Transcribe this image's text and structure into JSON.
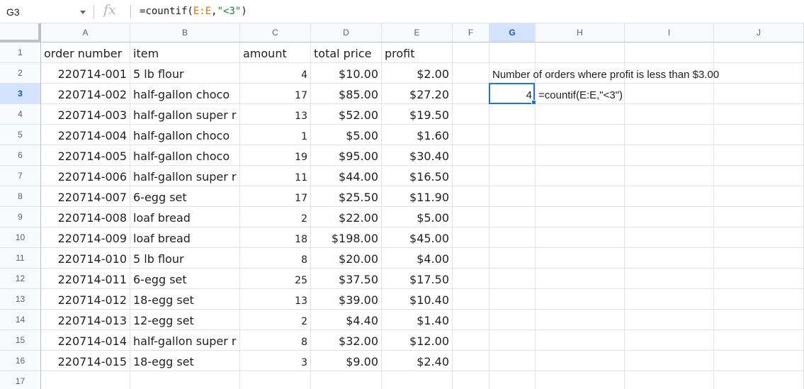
{
  "formula_bar": {
    "name_box": "G3",
    "fx_icon": "fx-icon",
    "formula_prefix": "=countif(",
    "formula_ref": "E:E",
    "formula_comma": ",",
    "formula_string": "\"<3\"",
    "formula_suffix": ")"
  },
  "columns": [
    "A",
    "B",
    "C",
    "D",
    "E",
    "F",
    "G",
    "H",
    "I",
    "J"
  ],
  "row_numbers": [
    "1",
    "2",
    "3",
    "4",
    "5",
    "6",
    "7",
    "8",
    "9",
    "10",
    "11",
    "12",
    "13",
    "14",
    "15",
    "16",
    "17"
  ],
  "headers": {
    "order_number": "order number",
    "item": "item",
    "amount": "amount",
    "total_price": "total price",
    "profit": "profit"
  },
  "rows": [
    {
      "order": "220714-001",
      "item": "5 lb flour",
      "amount": "4",
      "total": "$10.00",
      "profit": "$2.00"
    },
    {
      "order": "220714-002",
      "item": "half-gallon choco",
      "amount": "17",
      "total": "$85.00",
      "profit": "$27.20"
    },
    {
      "order": "220714-003",
      "item": "half-gallon super r",
      "amount": "13",
      "total": "$52.00",
      "profit": "$19.50"
    },
    {
      "order": "220714-004",
      "item": "half-gallon choco",
      "amount": "1",
      "total": "$5.00",
      "profit": "$1.60"
    },
    {
      "order": "220714-005",
      "item": "half-gallon choco",
      "amount": "19",
      "total": "$95.00",
      "profit": "$30.40"
    },
    {
      "order": "220714-006",
      "item": "half-gallon super r",
      "amount": "11",
      "total": "$44.00",
      "profit": "$16.50"
    },
    {
      "order": "220714-007",
      "item": "6-egg set",
      "amount": "17",
      "total": "$25.50",
      "profit": "$11.90"
    },
    {
      "order": "220714-008",
      "item": "loaf bread",
      "amount": "2",
      "total": "$22.00",
      "profit": "$5.00"
    },
    {
      "order": "220714-009",
      "item": "loaf bread",
      "amount": "18",
      "total": "$198.00",
      "profit": "$45.00"
    },
    {
      "order": "220714-010",
      "item": "5 lb flour",
      "amount": "8",
      "total": "$20.00",
      "profit": "$4.00"
    },
    {
      "order": "220714-011",
      "item": "6-egg set",
      "amount": "25",
      "total": "$37.50",
      "profit": "$17.50"
    },
    {
      "order": "220714-012",
      "item": "18-egg set",
      "amount": "13",
      "total": "$39.00",
      "profit": "$10.40"
    },
    {
      "order": "220714-013",
      "item": "12-egg set",
      "amount": "2",
      "total": "$4.40",
      "profit": "$1.40"
    },
    {
      "order": "220714-014",
      "item": "half-gallon super r",
      "amount": "8",
      "total": "$32.00",
      "profit": "$12.00"
    },
    {
      "order": "220714-015",
      "item": "18-egg set",
      "amount": "3",
      "total": "$9.00",
      "profit": "$2.40"
    }
  ],
  "g2_label": "Number of orders where profit is less than $3.00",
  "g3_value": "4",
  "h3_text": "=countif(E:E,\"<3\")",
  "selected_cell": "G3",
  "colors": {
    "selection": "#1a73e8",
    "header_selected": "#d3e3fd",
    "ref": "#e37400",
    "string": "#188038"
  }
}
